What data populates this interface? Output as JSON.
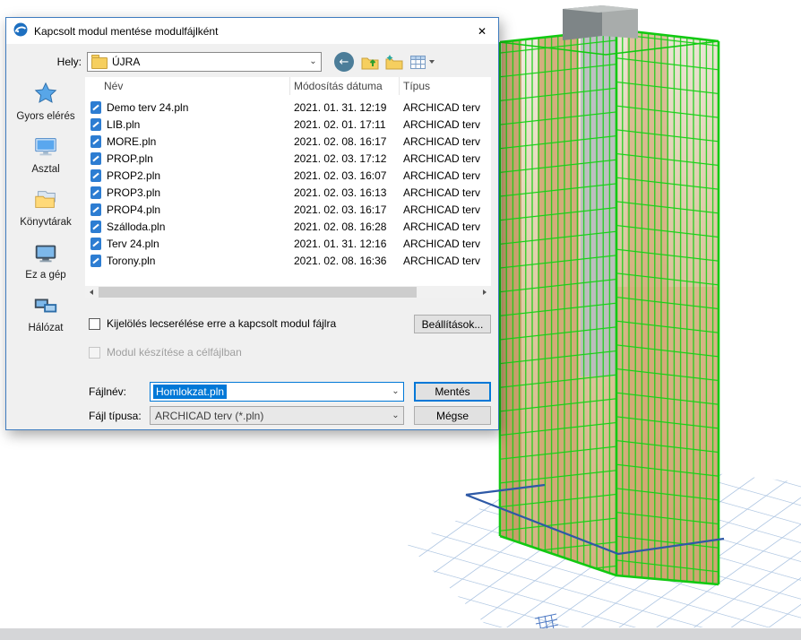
{
  "dialog": {
    "title": "Kapcsolt modul mentése modulfájlként",
    "toolbar": {
      "location_label": "Hely:",
      "location_value": "ÚJRA"
    },
    "sidebar": [
      {
        "label": "Gyors elérés"
      },
      {
        "label": "Asztal"
      },
      {
        "label": "Könyvtárak"
      },
      {
        "label": "Ez a gép"
      },
      {
        "label": "Hálózat"
      }
    ],
    "list": {
      "columns": {
        "name": "Név",
        "date": "Módosítás dátuma",
        "type": "Típus"
      }
    },
    "files": [
      {
        "name": "Demo terv 24.pln",
        "date": "2021. 01. 31. 12:19",
        "type": "ARCHICAD terv"
      },
      {
        "name": "LIB.pln",
        "date": "2021. 02. 01. 17:11",
        "type": "ARCHICAD terv"
      },
      {
        "name": "MORE.pln",
        "date": "2021. 02. 08. 16:17",
        "type": "ARCHICAD terv"
      },
      {
        "name": "PROP.pln",
        "date": "2021. 02. 03. 17:12",
        "type": "ARCHICAD terv"
      },
      {
        "name": "PROP2.pln",
        "date": "2021. 02. 03. 16:07",
        "type": "ARCHICAD terv"
      },
      {
        "name": "PROP3.pln",
        "date": "2021. 02. 03. 16:13",
        "type": "ARCHICAD terv"
      },
      {
        "name": "PROP4.pln",
        "date": "2021. 02. 03. 16:17",
        "type": "ARCHICAD terv"
      },
      {
        "name": "Szálloda.pln",
        "date": "2021. 02. 08. 16:28",
        "type": "ARCHICAD terv"
      },
      {
        "name": "Terv 24.pln",
        "date": "2021. 01. 31. 12:16",
        "type": "ARCHICAD terv"
      },
      {
        "name": "Torony.pln",
        "date": "2021. 02. 08. 16:36",
        "type": "ARCHICAD terv"
      }
    ],
    "options": {
      "replace_checkbox_label": "Kijelölés lecserélése erre a kapcsolt modul fájlra",
      "settings_button": "Beállítások...",
      "module_checkbox_label": "Modul készítése a célfájlban"
    },
    "fields": {
      "filename_label": "Fájlnév:",
      "filename_value": "Homlokzat.pln",
      "filetype_label": "Fájl típusa:",
      "filetype_value": "ARCHICAD terv (*.pln)"
    },
    "actions": {
      "save": "Mentés",
      "cancel": "Mégse"
    }
  },
  "icons": {
    "close_glyph": "✕",
    "back_glyph": "←",
    "chevron_glyph": "⌄",
    "sort_glyph": "^"
  },
  "colors": {
    "accent": "#0078d7",
    "dialog_border": "#3f7cbf",
    "wireframe_green": "#15cf15",
    "slab_tan": "#cfa873",
    "grid_blue": "#a3bedd",
    "base_outline_blue": "#2e59a6"
  }
}
